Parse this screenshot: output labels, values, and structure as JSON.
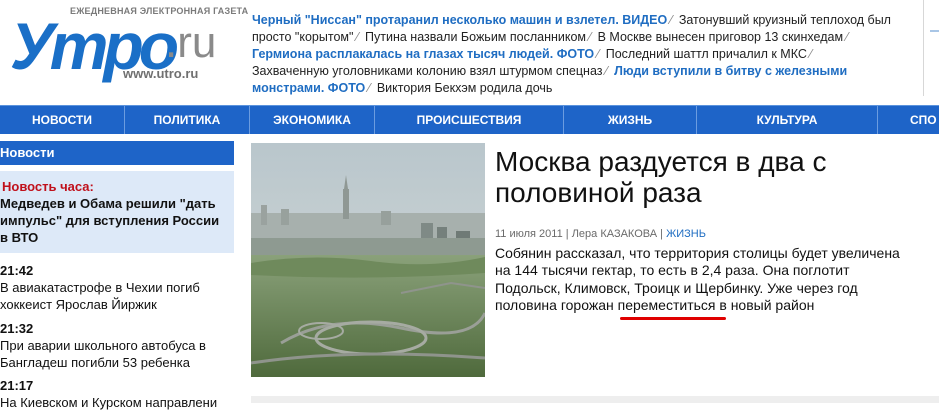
{
  "header": {
    "logo": {
      "tagline": "ЕЖЕДНЕВНАЯ ЭЛЕКТРОННАЯ ГАЗЕТА",
      "word": "Утро",
      "tld": ".ru",
      "url": "www.utro.ru",
      "brand_color": "#1a6fc7"
    },
    "ticker": [
      {
        "text": "Черный \"Ниссан\" протаранил несколько машин и взлетел. ВИДЕО",
        "highlight": true
      },
      {
        "text": "Затонувший круизный теплоход был просто \"корытом\"",
        "highlight": false
      },
      {
        "text": "Путина назвали Божьим посланником",
        "highlight": false
      },
      {
        "text": "В Москве вынесен приговор 13 скинхедам",
        "highlight": false
      },
      {
        "text": "Гермиона расплакалась на глазах тысяч людей. ФОТО",
        "highlight": true
      },
      {
        "text": "Последний шаттл причалил к МКС",
        "highlight": false
      },
      {
        "text": "Захваченную уголовниками колонию взял штурмом спецназ",
        "highlight": false
      },
      {
        "text": "Люди вступили в битву с железными монстрами. ФОТО",
        "highlight": true
      },
      {
        "text": "Виктория Бекхэм родила дочь",
        "highlight": false
      }
    ]
  },
  "nav": {
    "items": [
      "НОВОСТИ",
      "ПОЛИТИКА",
      "ЭКОНОМИКА",
      "ПРОИСШЕСТВИЯ",
      "ЖИЗНЬ",
      "КУЛЬТУРА",
      "СПО"
    ]
  },
  "sidebar": {
    "title": "Новости",
    "hour": {
      "label": "Новость часа:",
      "text": "Медведев и Обама решили \"дать импульс\" для вступления России в ВТО"
    },
    "feed": [
      {
        "time": "21:42",
        "text": "В авиакатастрофе в Чехии погиб хоккеист Ярослав Йиржик"
      },
      {
        "time": "21:32",
        "text": "При аварии школьного автобуса в Бангладеш погибли 53 ребенка"
      },
      {
        "time": "21:17",
        "text": "На Киевском и Курском направлени"
      }
    ]
  },
  "article": {
    "title": "Москва раздуется в два с половиной раза",
    "date": "11 июля 2011",
    "author": "Лера КАЗАКОВА",
    "category": "ЖИЗНЬ",
    "body_before": "Собянин рассказал, что территория столицы будет увеличена на 144 тысячи гектар, то есть в 2,4 раза. Она поглотит Подольск, Климовск, Троицк и Щербинку. Уже через год половина горожан ",
    "body_highlight": "переместиться",
    "body_after": " в новый район"
  },
  "colors": {
    "nav_bg": "#1e64c8",
    "link": "#1f6dc2",
    "hour_label": "#c0101b",
    "hour_bg": "#dde9f8",
    "annotation": "#e00000"
  }
}
